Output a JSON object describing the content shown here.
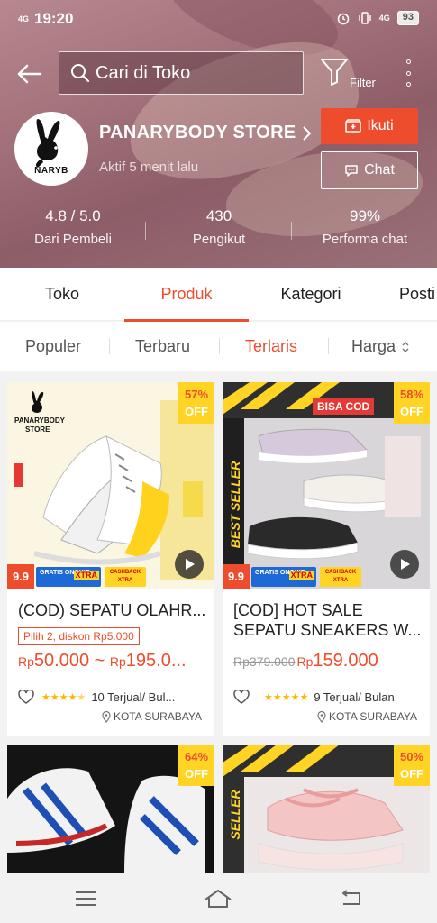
{
  "status_bar": {
    "net": "4G",
    "time": "19:20",
    "net_right": "4G",
    "battery": "93"
  },
  "search": {
    "placeholder": "Cari di Toko"
  },
  "filter_label": "Filter",
  "store": {
    "name": "PANARYBODY STORE",
    "logo_text": "NARYB",
    "active": "Aktif 5 menit lalu",
    "follow_label": "Ikuti",
    "chat_label": "Chat"
  },
  "stats": [
    {
      "value": "4.8 / 5.0",
      "label": "Dari Pembeli"
    },
    {
      "value": "430",
      "label": "Pengikut"
    },
    {
      "value": "99%",
      "label": "Performa chat"
    }
  ],
  "tabs": [
    "Toko",
    "Produk",
    "Kategori",
    "Posti"
  ],
  "active_tab": "Produk",
  "sort": [
    "Populer",
    "Terbaru",
    "Terlaris",
    "Harga"
  ],
  "active_sort": "Terlaris",
  "products": [
    {
      "discount": "57%",
      "off": "OFF",
      "title": "(COD) SEPATU OLAHR...",
      "promo": "Pilih 2, diskon Rp5.000",
      "price_prefix": "Rp",
      "price": "50.000",
      "price_sep": " ~ ",
      "price2_prefix": "Rp",
      "price2": "195.0...",
      "rating": 4.5,
      "sold": "10 Terjual/ Bul...",
      "location": "KOTA SURABAYA",
      "img_brand": "PANARYBODY",
      "img_brand2": "STORE"
    },
    {
      "discount": "58%",
      "off": "OFF",
      "title": "[COD] HOT SALE SEPATU SNEAKERS W...",
      "old_price": "Rp379.000",
      "price_prefix": "Rp",
      "price": "159.000",
      "rating": 5,
      "sold": "9 Terjual/ Bulan",
      "location": "KOTA SURABAYA",
      "img_banner": "BISA COD",
      "img_side": "BEST SELLER"
    },
    {
      "discount": "64%",
      "off": "OFF"
    },
    {
      "discount": "50%",
      "off": "OFF",
      "img_side": "SELLER"
    }
  ],
  "promo_strip": {
    "nine": "9.9",
    "ongkir": "GRATIS ONGKIR",
    "xtra": "XTRA",
    "cashback": "CASHBACK",
    "cb_xtra": "XTRA"
  },
  "colors": {
    "accent": "#ee4d2d",
    "badge": "#ffd424",
    "star": "#ffb700"
  }
}
